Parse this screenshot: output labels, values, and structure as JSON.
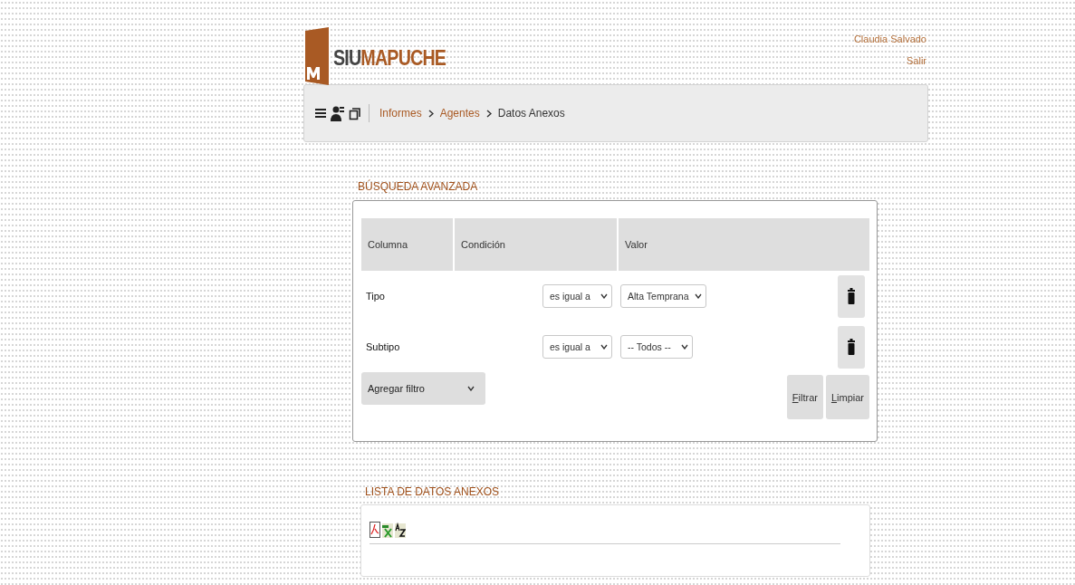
{
  "header": {
    "logo": {
      "prefix": "SIU",
      "name": "MAPUCHE"
    },
    "user": "Claudia Salvado",
    "logout": "Salir"
  },
  "breadcrumb": [
    {
      "label": "Informes",
      "link": true
    },
    {
      "label": "Agentes",
      "link": true
    },
    {
      "label": "Datos Anexos",
      "link": false
    }
  ],
  "search": {
    "title": "BÚSQUEDA AVANZADA",
    "columns": [
      "Columna",
      "Condición",
      "Valor"
    ],
    "filters": [
      {
        "column": "Tipo",
        "condition": "es igual a",
        "value": "Alta Temprana"
      },
      {
        "column": "Subtipo",
        "condition": "es igual a",
        "value": "-- Todos --"
      }
    ],
    "add_filter": "Agregar filtro",
    "buttons": [
      {
        "label": "Filtrar",
        "underline_first": true
      },
      {
        "label": "Limpiar",
        "underline_first": true
      }
    ]
  },
  "list": {
    "title": "LISTA DE DATOS ANEXOS"
  }
}
